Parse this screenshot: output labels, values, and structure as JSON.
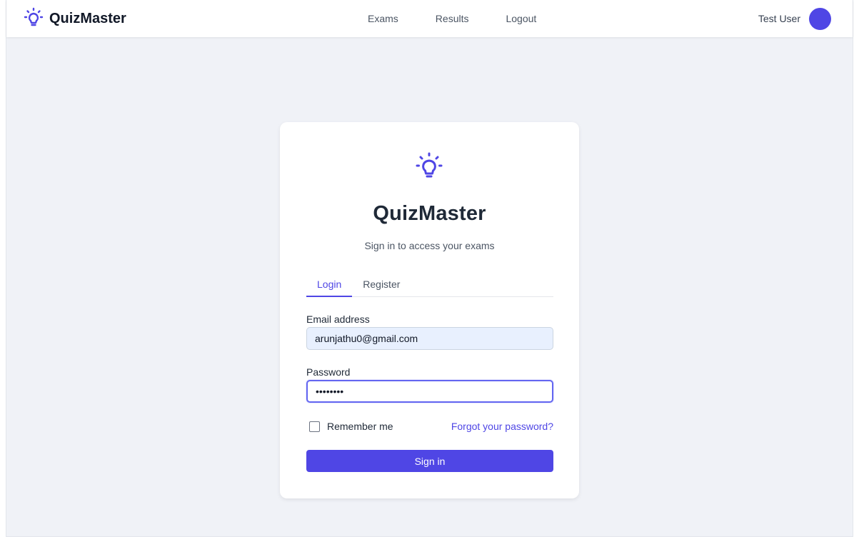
{
  "app": {
    "brand_name": "QuizMaster",
    "brand_icon": "lightbulb-icon",
    "accent_color": "#4f46e5"
  },
  "navbar": {
    "links": [
      {
        "label": "Exams"
      },
      {
        "label": "Results"
      },
      {
        "label": "Logout"
      }
    ],
    "user_name": "Test User",
    "avatar_color": "#4f46e5"
  },
  "login_card": {
    "title": "QuizMaster",
    "subtitle": "Sign in to access your exams",
    "tabs": [
      {
        "label": "Login",
        "active": true
      },
      {
        "label": "Register",
        "active": false
      }
    ],
    "email": {
      "label": "Email address",
      "value": "arunjathu0@gmail.com"
    },
    "password": {
      "label": "Password",
      "value": "••••••••"
    },
    "remember_me": {
      "label": "Remember me",
      "checked": false
    },
    "forgot_password_label": "Forgot your password?",
    "submit_label": "Sign in"
  }
}
